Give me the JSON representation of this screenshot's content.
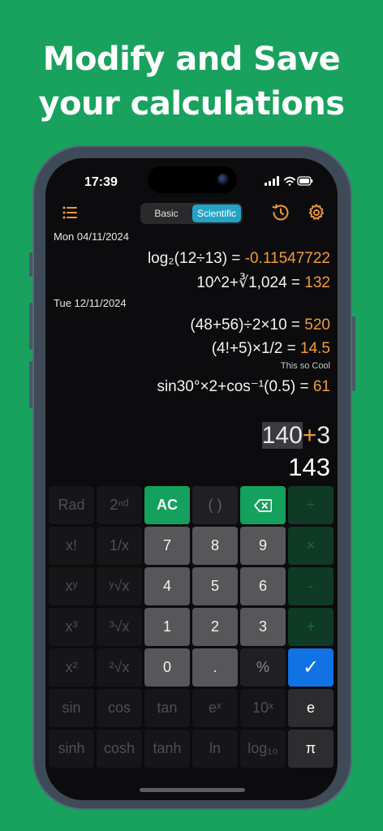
{
  "promo": {
    "line1": "Modify and Save",
    "line2": "your calculations"
  },
  "status": {
    "time": "17:39"
  },
  "toolbar": {
    "menu_icon": "list-icon",
    "history_icon": "history-clock-icon",
    "settings_icon": "gear-icon",
    "accent": "#f19a38"
  },
  "mode": {
    "basic": "Basic",
    "scientific": "Scientific",
    "selected": "Scientific",
    "selected_color": "#23a3c6"
  },
  "history": [
    {
      "date": "Mon 04/11/2024",
      "entries": [
        {
          "expr": "log₂(12÷13) = ",
          "result": "-0.11547722"
        },
        {
          "expr": "10^2+∛1,024 = ",
          "result": "132"
        }
      ]
    },
    {
      "date": "Tue 12/11/2024",
      "entries": [
        {
          "expr": "(48+56)÷2×10 = ",
          "result": "520"
        },
        {
          "expr": "(4!+5)×1/2 = ",
          "result": "14.5"
        },
        {
          "note": "This so Cool",
          "expr": "sin30°×2+cos⁻¹(0.5) = ",
          "result": "61"
        }
      ]
    }
  ],
  "display": {
    "operand1": "140",
    "operator": "+",
    "operand2": "3",
    "result": "143"
  },
  "keys": {
    "row1": [
      "Rad",
      "2ⁿᵈ",
      "AC",
      "( )",
      "backspace",
      "÷"
    ],
    "row2": [
      "x!",
      "1/x",
      "7",
      "8",
      "9",
      "×"
    ],
    "row3": [
      "xʸ",
      "ʸ√x",
      "4",
      "5",
      "6",
      "-"
    ],
    "row4": [
      "x³",
      "³√x",
      "1",
      "2",
      "3",
      "+"
    ],
    "row5": [
      "x²",
      "²√x",
      "0",
      ".",
      "%",
      "✓"
    ],
    "row6": [
      "sin",
      "cos",
      "tan",
      "eˣ",
      "10ˣ",
      "e"
    ],
    "row7": [
      "sinh",
      "cosh",
      "tanh",
      "ln",
      "log₁₀",
      "π"
    ]
  },
  "colors": {
    "background": "#18a25e",
    "ac_key": "#14a05d",
    "confirm_key": "#1172e4"
  }
}
